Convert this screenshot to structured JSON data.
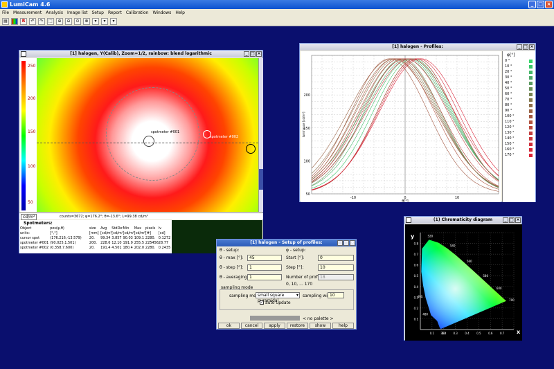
{
  "app": {
    "title": "LumiCam 4.6"
  },
  "menu": [
    "File",
    "Measurement",
    "Analysis",
    "Image list",
    "Setup",
    "Report",
    "Calibration",
    "Windows",
    "Help"
  ],
  "toolbar": {
    "red_r": "R"
  },
  "image_window": {
    "title": "[1] halogen, Y(Calib), Zoom=1/2, rainbow: blend logarithmic",
    "scale_ticks": [
      "250",
      "200",
      "150",
      "100",
      "50"
    ],
    "unit_label": "cd/m²",
    "status": "counts=3672; φ=176.2°; θ=-13.6°; L=99.38 cd/m²",
    "spot1": "spotmeter #001",
    "spot2": "spotmeter #002"
  },
  "spotmeters": {
    "title": "Spotmeters:",
    "headers": [
      "Object",
      "pos(φ,θ)",
      "size",
      "Avg",
      "StdDev",
      "Min",
      "Max",
      "pixels",
      "lv"
    ],
    "units": [
      "units:",
      "[°,°]",
      "[mm]",
      "[cd/m²]",
      "[cd/m²]",
      "[cd/m²]",
      "[cd/m²]",
      "[#]",
      "[cd]"
    ],
    "rows": [
      [
        "cursor spot",
        "(176.216,-13.579)",
        "20.",
        "99.34",
        "3.857",
        "90.03",
        "109.1",
        "2280.",
        "0.1272"
      ],
      [
        "spotmeter #001",
        "(90.025,1.501)",
        "200.",
        "228.6",
        "12.10",
        "191.9",
        "255.5",
        "225456.",
        "28.77"
      ],
      [
        "spotmeter #002",
        "(0.358,7.600)",
        "20.",
        "191.4",
        "4.501",
        "180.4",
        "202.0",
        "2280.",
        "0.2435"
      ]
    ]
  },
  "profiles_window": {
    "title": "[1] halogen - Profiles:",
    "legend_header": "φ[°]",
    "yticks": [
      "50",
      "100",
      "150",
      "200"
    ],
    "xticks": [
      "-10",
      "0",
      "10"
    ],
    "ylabel": "luminance [cd/m²]",
    "xlabel": "θ[°]"
  },
  "chart_data": {
    "type": "line",
    "xlabel": "θ[°]",
    "ylabel": "luminance [cd/m²]",
    "xlim": [
      -18,
      18
    ],
    "ylim": [
      50,
      260
    ],
    "series_names": [
      "0 °",
      "10 °",
      "20 °",
      "30 °",
      "40 °",
      "50 °",
      "60 °",
      "70 °",
      "80 °",
      "90 °",
      "100 °",
      "110 °",
      "120 °",
      "130 °",
      "140 °",
      "150 °",
      "160 °",
      "170 °"
    ],
    "series_colors": [
      "#38d86a",
      "#3ac76a",
      "#46b86a",
      "#4fa86a",
      "#5c9c62",
      "#6a8f5a",
      "#7a8656",
      "#857a50",
      "#8f704c",
      "#9a6446",
      "#a45a44",
      "#b25440",
      "#ba4a40",
      "#c24040",
      "#c8383e",
      "#ce303c",
      "#d42a3a",
      "#da2438"
    ],
    "peak_x": [
      2,
      1.5,
      1,
      0.5,
      0,
      -0.5,
      -1,
      -1.5,
      -2,
      -2.5,
      -3,
      -2,
      -1,
      0,
      1,
      2,
      2.5,
      3
    ],
    "peak_y": 255,
    "half_width": 11
  },
  "chroma_window": {
    "title": "(1) Chromaticity diagram",
    "yaxis": "y",
    "xaxis": "x",
    "yticks": [
      "0.8",
      "0.7",
      "0.6",
      "0.5",
      "0.4",
      "0.3",
      "0.2",
      "0.1"
    ],
    "xticks": [
      "0.1",
      "0.2",
      "0.3",
      "0.4",
      "0.5",
      "0.6",
      "0.7"
    ],
    "wavelengths": [
      "520",
      "540",
      "560",
      "580",
      "600",
      "700",
      "490",
      "480",
      "380"
    ]
  },
  "setup_window": {
    "title": "[1] halogen - Setup of profiles:",
    "theta_setup": "θ - setup:",
    "phi_setup": "φ - setup:",
    "theta_max_label": "θ - max [°]:",
    "theta_max": "45",
    "theta_step_label": "θ - step [°]:",
    "theta_step": "1",
    "theta_avg_label": "θ - averaging [°]:",
    "theta_avg": "1",
    "start_label": "Start [°]:",
    "start": "0",
    "step_label": "Step [°]:",
    "step": "10",
    "num_label": "Number of profiles:",
    "num": "18",
    "range": "0, 10, ... 170",
    "sampling_title": "sampling mode",
    "sampling_label": "sampling mode:",
    "sampling_value": "small square pyramidal",
    "width_label": "sampling width:",
    "width": "10",
    "auto": "auto update",
    "palette": "< no palette >",
    "buttons": [
      "ok",
      "cancel",
      "apply",
      "restore",
      "show",
      "help"
    ]
  }
}
